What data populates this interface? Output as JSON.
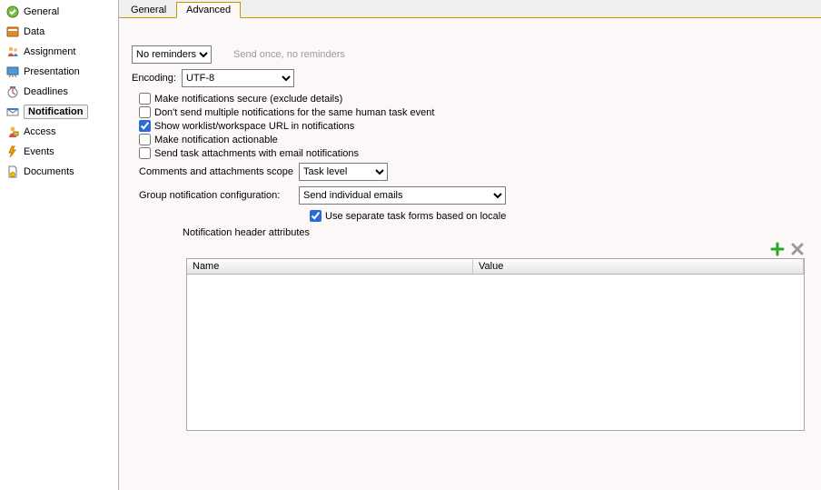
{
  "sidebar": {
    "items": [
      {
        "label": "General",
        "icon": "general"
      },
      {
        "label": "Data",
        "icon": "data"
      },
      {
        "label": "Assignment",
        "icon": "assignment"
      },
      {
        "label": "Presentation",
        "icon": "presentation"
      },
      {
        "label": "Deadlines",
        "icon": "deadlines"
      },
      {
        "label": "Notification",
        "icon": "notification",
        "selected": true
      },
      {
        "label": "Access",
        "icon": "access"
      },
      {
        "label": "Events",
        "icon": "events"
      },
      {
        "label": "Documents",
        "icon": "documents"
      }
    ]
  },
  "tabs": {
    "general": "General",
    "advanced": "Advanced",
    "active": "advanced"
  },
  "reminders": {
    "value": "No reminders",
    "hint": "Send once, no reminders"
  },
  "encoding": {
    "label": "Encoding:",
    "value": "UTF-8"
  },
  "checks": {
    "secure": "Make notifications secure (exclude details)",
    "nodup": "Don't send multiple notifications for the same human task event",
    "showurl": "Show worklist/workspace URL in notifications",
    "actionable": "Make notification actionable",
    "attachments": "Send task attachments with email notifications",
    "locale": "Use separate task forms based on locale"
  },
  "checked": {
    "secure": false,
    "nodup": false,
    "showurl": true,
    "actionable": false,
    "attachments": false,
    "locale": true
  },
  "scope": {
    "label": "Comments and attachments scope",
    "value": "Task level"
  },
  "groupnotif": {
    "label": "Group notification configuration:",
    "value": "Send individual emails"
  },
  "headerattrs": {
    "label": "Notification header attributes",
    "cols": {
      "name": "Name",
      "value": "Value"
    }
  }
}
